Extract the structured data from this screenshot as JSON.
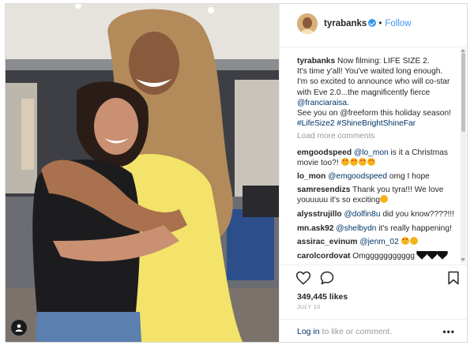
{
  "post": {
    "username": "tyrabanks",
    "dot": "•",
    "follow_label": "Follow",
    "caption": {
      "username": "tyrabanks",
      "lines": [
        "Now filming: LIFE SIZE 2.",
        "It's time y'all! You've waited long enough.",
        "I'm so excited to announce who will co-star",
        "with Eve 2.0...the magnificently fierce",
        "@franciaraisa.",
        "See you on @freeform this holiday season!",
        "#LifeSize2 #ShineBrightShineFar"
      ]
    },
    "load_more": "Load more comments",
    "comments": [
      {
        "user": "emgoodspeed",
        "mention": "@lo_mon",
        "text": "is it a Christmas",
        "cont": "movie too?!"
      },
      {
        "user": "lo_mon",
        "mention": "@emgoodspeed",
        "text": "omg I hope"
      },
      {
        "user": "samresendizs",
        "text": "Thank you tyra!!! We love",
        "cont": "youuuuu it's so exciting"
      },
      {
        "user": "alysstrujillo",
        "mention": "@dolfin8u",
        "text": "did you know????!!!"
      },
      {
        "user": "mn.ask92",
        "mention": "@shelbydn",
        "text": "it's really happening!"
      },
      {
        "user": "assirac_evinum",
        "mention": "@jenm_02",
        "text": ""
      },
      {
        "user": "carolcordovat",
        "text": "Omggggggggggg"
      }
    ],
    "likes": "349,445 likes",
    "date": "JULY 10",
    "login": {
      "link": "Log in",
      "text": "to like or comment."
    },
    "more_label": "•••"
  },
  "icons": {
    "tag": "user-tag-icon",
    "heart": "heart-icon",
    "comment": "comment-icon",
    "bookmark": "bookmark-icon",
    "verified": "verified-badge-icon"
  },
  "colors": {
    "accent": "#3897f0",
    "link": "#003569",
    "muted": "#999999"
  }
}
